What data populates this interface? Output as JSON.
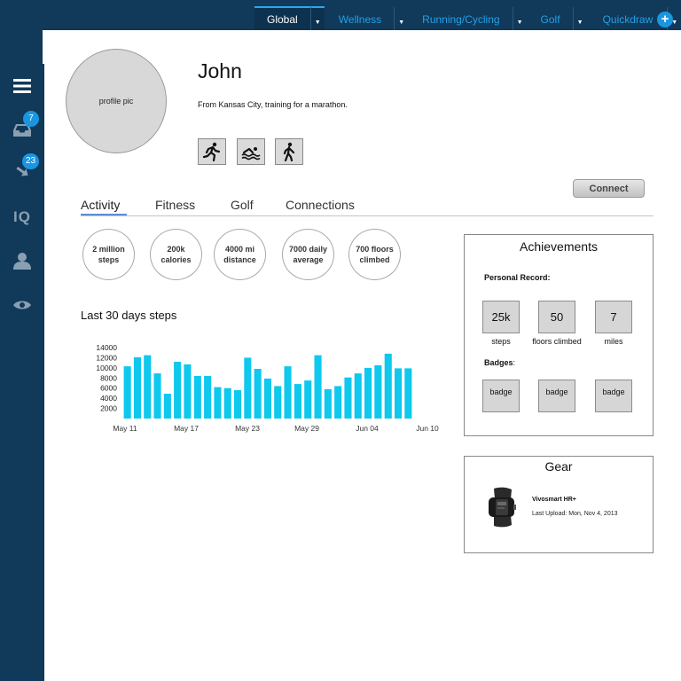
{
  "topnav": {
    "tabs": [
      {
        "label": "Global",
        "active": true
      },
      {
        "label": "Wellness",
        "active": false
      },
      {
        "label": "Running/Cycling",
        "active": false
      },
      {
        "label": "Golf",
        "active": false
      },
      {
        "label": "Quickdraw",
        "active": false
      }
    ],
    "add_label": "+"
  },
  "sidebar": {
    "items": [
      {
        "name": "menu",
        "icon": "hamburger-menu-icon"
      },
      {
        "name": "inbox",
        "icon": "inbox-icon",
        "badge": "7"
      },
      {
        "name": "connections",
        "icon": "arrows-icon",
        "badge": "23"
      },
      {
        "name": "iq",
        "icon": "iq-icon",
        "text": "IQ"
      },
      {
        "name": "profile",
        "icon": "user-icon"
      },
      {
        "name": "view",
        "icon": "eye-icon"
      }
    ]
  },
  "profile": {
    "pic_label": "profile pic",
    "name": "John",
    "bio": "From Kansas City, training for a marathon.",
    "sports": [
      "running-icon",
      "swimming-icon",
      "walking-icon"
    ],
    "connect_label": "Connect"
  },
  "tabs": {
    "items": [
      {
        "label": "Activity",
        "active": true
      },
      {
        "label": "Fitness",
        "active": false
      },
      {
        "label": "Golf",
        "active": false
      },
      {
        "label": "Connections",
        "active": false
      }
    ]
  },
  "stats": [
    {
      "label": "2 million steps"
    },
    {
      "label": "200k calories"
    },
    {
      "label": "4000 mi distance"
    },
    {
      "label": "7000 daily average"
    },
    {
      "label": "700 floors climbed"
    }
  ],
  "steps_chart": {
    "title": "Last 30 days steps"
  },
  "chart_data": {
    "type": "bar",
    "title": "Last 30 days steps",
    "xlabel": "",
    "ylabel": "",
    "ylim": [
      0,
      14000
    ],
    "yticks": [
      14000,
      12000,
      10000,
      8000,
      6000,
      4000,
      2000
    ],
    "x_tick_labels": [
      "May 11",
      "May 17",
      "May 23",
      "May 29",
      "Jun 04",
      "Jun 10"
    ],
    "values": [
      10300,
      12100,
      12500,
      8900,
      4900,
      11200,
      10700,
      8400,
      8400,
      6200,
      6000,
      5600,
      12000,
      9800,
      7900,
      6400,
      10300,
      6800,
      7500,
      12500,
      5800,
      6400,
      8100,
      8900,
      10000,
      10500,
      12800,
      9900,
      9900
    ],
    "color": "#0ec8ee",
    "grid": false
  },
  "achievements": {
    "title": "Achievements",
    "personal_record_label": "Personal Record:",
    "records": [
      {
        "value": "25k",
        "label": "steps"
      },
      {
        "value": "50",
        "label": "floors climbed"
      },
      {
        "value": "7",
        "label": "miles"
      }
    ],
    "badges_label": "Badges",
    "badges_colon": ":",
    "badges": [
      "badge",
      "badge",
      "badge"
    ]
  },
  "gear": {
    "title": "Gear",
    "device_name": "Vivosmart HR+",
    "last_upload": "Last Upload: Mon, Nov 4, 2013"
  },
  "colors": {
    "sidebar_bg": "#10395a",
    "accent": "#1a96e0",
    "bar": "#0ec8ee"
  }
}
